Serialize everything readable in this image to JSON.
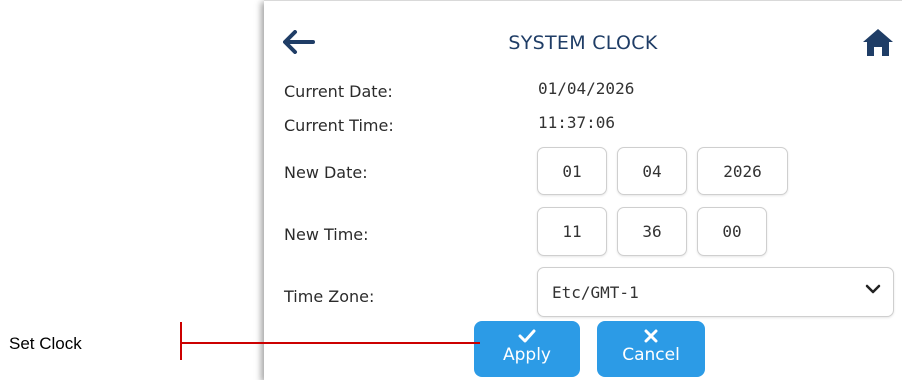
{
  "header": {
    "title": "SYSTEM CLOCK",
    "back_icon": "arrow-left-icon",
    "home_icon": "home-icon"
  },
  "current": {
    "date_label": "Current Date:",
    "date_value": "01/04/2026",
    "time_label": "Current Time:",
    "time_value": "11:37:06"
  },
  "new_date": {
    "label": "New Date:",
    "day": "01",
    "month": "04",
    "year": "2026"
  },
  "new_time": {
    "label": "New Time:",
    "hour": "11",
    "minute": "36",
    "second": "00"
  },
  "timezone": {
    "label": "Time Zone:",
    "selected": "Etc/GMT-1",
    "chevron_icon": "chevron-down-icon"
  },
  "buttons": {
    "apply_label": "Apply",
    "apply_icon": "check-icon",
    "cancel_label": "Cancel",
    "cancel_icon": "close-icon"
  },
  "callout": {
    "text": "Set Clock"
  },
  "colors": {
    "title": "#1f3d66",
    "button": "#2c9be6",
    "callout_line": "#cc0000"
  }
}
